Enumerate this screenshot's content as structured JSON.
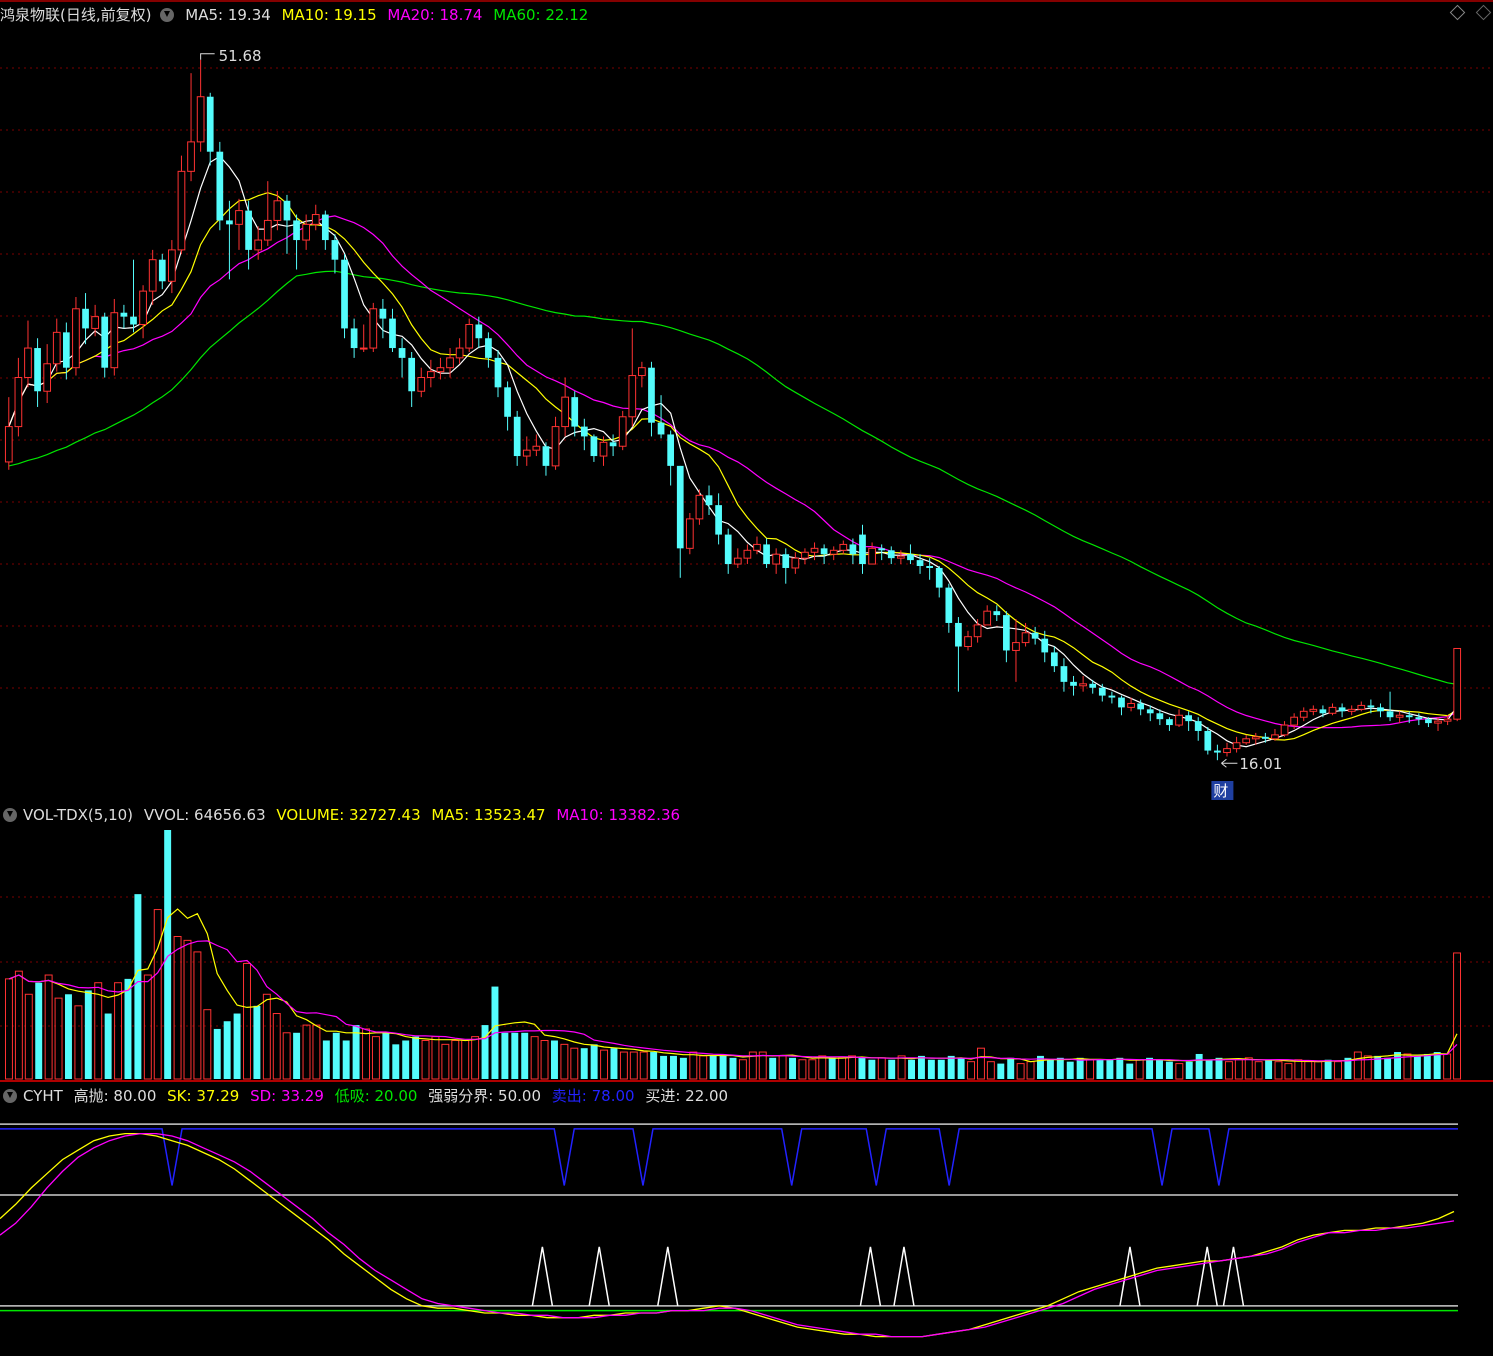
{
  "main_panel": {
    "title": "鸿泉物联(日线,前复权)",
    "ma5": "MA5: 19.34",
    "ma10": "MA10: 19.15",
    "ma20": "MA20: 18.74",
    "ma60": "MA60: 22.12",
    "high_label": "51.68",
    "low_label": "16.01",
    "event_badge": "财"
  },
  "volume_panel": {
    "title": "VOL-TDX(5,10)",
    "vvol": "VVOL: 64656.63",
    "volume": "VOLUME: 32727.43",
    "ma5": "MA5: 13523.47",
    "ma10": "MA10: 13382.36"
  },
  "indicator_panel": {
    "title": "CYHT",
    "gaopao": "高抛: 80.00",
    "sk": "SK: 37.29",
    "sd": "SD: 33.29",
    "dixi": "低吸: 20.00",
    "fenjie": "强弱分界: 50.00",
    "maichu": "卖出: 78.00",
    "mairu": "买进: 22.00"
  },
  "colors": {
    "up": "#ff3232",
    "down": "#54fcfc",
    "ma5": "#ffffff",
    "ma10": "#ffff00",
    "ma20": "#ff00ff",
    "ma60": "#00e600",
    "grid": "#7a0000",
    "divider": "#b00000",
    "sell": "#2222ff",
    "buy": "#ffffff"
  },
  "chart_data": [
    {
      "type": "candlestick",
      "ylim": [
        14.9,
        53.3
      ],
      "high": 51.68,
      "low": 16.01,
      "candles": [
        [
          33.0,
          31.2,
          34.5,
          30.8
        ],
        [
          35.5,
          33.0,
          36.5,
          32.5
        ],
        [
          37.0,
          35.5,
          38.4,
          35.0
        ],
        [
          34.8,
          37.0,
          37.5,
          34.0
        ],
        [
          36.2,
          34.8,
          37.2,
          34.2
        ],
        [
          37.8,
          36.2,
          38.5,
          35.8
        ],
        [
          36.0,
          37.8,
          38.3,
          35.4
        ],
        [
          39.0,
          36.0,
          39.6,
          35.6
        ],
        [
          38.0,
          39.0,
          39.8,
          37.2
        ],
        [
          38.6,
          38.0,
          39.2,
          37.6
        ],
        [
          36.0,
          38.6,
          38.8,
          35.5
        ],
        [
          38.8,
          36.0,
          39.5,
          35.6
        ],
        [
          38.6,
          38.8,
          39.2,
          38.0
        ],
        [
          38.2,
          38.6,
          41.5,
          37.8
        ],
        [
          39.9,
          38.2,
          40.2,
          37.5
        ],
        [
          41.5,
          39.9,
          42.0,
          39.2
        ],
        [
          40.4,
          41.5,
          41.8,
          40.0
        ],
        [
          42.0,
          40.4,
          42.5,
          39.8
        ],
        [
          46.0,
          42.0,
          46.8,
          41.8
        ],
        [
          47.5,
          46.0,
          51.0,
          45.5
        ],
        [
          49.8,
          47.5,
          51.68,
          47.0
        ],
        [
          47.0,
          49.8,
          50.0,
          46.3
        ],
        [
          43.5,
          47.0,
          47.5,
          43.0
        ],
        [
          43.3,
          43.5,
          44.5,
          40.5
        ],
        [
          44.0,
          43.3,
          44.6,
          42.0
        ],
        [
          42.0,
          44.0,
          44.5,
          41.0
        ],
        [
          42.5,
          42.0,
          43.2,
          41.5
        ],
        [
          43.5,
          42.5,
          45.5,
          42.2
        ],
        [
          44.5,
          43.5,
          45.0,
          43.0
        ],
        [
          43.5,
          44.5,
          44.8,
          41.8
        ],
        [
          42.5,
          43.5,
          43.8,
          41.0
        ],
        [
          43.3,
          42.5,
          43.8,
          42.0
        ],
        [
          43.8,
          43.3,
          44.3,
          43.0
        ],
        [
          42.5,
          43.8,
          44.0,
          42.0
        ],
        [
          41.5,
          42.5,
          42.8,
          40.8
        ],
        [
          38.0,
          41.5,
          41.8,
          37.5
        ],
        [
          37.0,
          38.0,
          38.5,
          36.5
        ],
        [
          37.0,
          37.0,
          38.2,
          36.8
        ],
        [
          39.0,
          37.0,
          39.3,
          36.8
        ],
        [
          38.5,
          39.0,
          39.5,
          37.5
        ],
        [
          37.0,
          38.5,
          39.0,
          36.8
        ],
        [
          36.5,
          37.0,
          37.5,
          35.5
        ],
        [
          34.8,
          36.5,
          36.8,
          34.0
        ],
        [
          35.5,
          34.8,
          36.0,
          34.5
        ],
        [
          35.8,
          35.5,
          36.4,
          35.0
        ],
        [
          36.0,
          35.8,
          36.5,
          35.4
        ],
        [
          36.5,
          36.0,
          37.0,
          35.5
        ],
        [
          37.0,
          36.5,
          37.5,
          36.2
        ],
        [
          38.2,
          37.0,
          38.5,
          36.8
        ],
        [
          37.5,
          38.2,
          38.6,
          37.0
        ],
        [
          36.5,
          37.5,
          37.8,
          36.0
        ],
        [
          35.0,
          36.5,
          36.9,
          34.5
        ],
        [
          33.5,
          35.0,
          35.3,
          32.8
        ],
        [
          31.5,
          33.5,
          33.8,
          31.0
        ],
        [
          31.8,
          31.5,
          32.5,
          31.0
        ],
        [
          32.0,
          31.8,
          32.6,
          31.5
        ],
        [
          31.0,
          32.0,
          32.2,
          30.5
        ],
        [
          33.0,
          31.0,
          33.5,
          30.8
        ],
        [
          34.5,
          33.0,
          35.5,
          32.5
        ],
        [
          33.0,
          34.5,
          34.8,
          32.5
        ],
        [
          32.5,
          33.0,
          33.4,
          31.8
        ],
        [
          31.5,
          32.5,
          32.6,
          31.2
        ],
        [
          32.2,
          31.5,
          32.5,
          31.0
        ],
        [
          32.0,
          32.2,
          32.6,
          31.5
        ],
        [
          33.5,
          32.0,
          33.8,
          31.8
        ],
        [
          35.6,
          33.5,
          38.0,
          33.0
        ],
        [
          36.0,
          35.6,
          36.3,
          35.0
        ],
        [
          33.2,
          36.0,
          36.3,
          32.5
        ],
        [
          32.6,
          33.2,
          34.6,
          32.4
        ],
        [
          31.0,
          32.6,
          32.8,
          30.0
        ],
        [
          26.8,
          31.0,
          31.0,
          25.3
        ],
        [
          28.3,
          26.8,
          28.6,
          26.5
        ],
        [
          29.5,
          28.3,
          29.8,
          28.0
        ],
        [
          29.0,
          29.5,
          30.0,
          28.5
        ],
        [
          27.5,
          29.0,
          29.6,
          27.0
        ],
        [
          26.0,
          27.5,
          27.8,
          25.5
        ],
        [
          26.3,
          26.0,
          26.8,
          25.8
        ],
        [
          26.7,
          26.3,
          27.0,
          26.0
        ],
        [
          27.0,
          26.7,
          27.4,
          26.5
        ],
        [
          26.0,
          27.0,
          27.3,
          25.8
        ],
        [
          26.5,
          26.0,
          26.8,
          25.5
        ],
        [
          25.8,
          26.5,
          26.8,
          25.0
        ],
        [
          26.3,
          25.8,
          26.6,
          25.5
        ],
        [
          26.6,
          26.3,
          26.8,
          26.0
        ],
        [
          26.8,
          26.6,
          27.1,
          26.2
        ],
        [
          26.5,
          26.8,
          27.0,
          26.0
        ],
        [
          26.7,
          26.5,
          26.9,
          26.2
        ],
        [
          27.0,
          26.7,
          27.2,
          26.5
        ],
        [
          26.5,
          27.0,
          27.3,
          26.0
        ],
        [
          26.0,
          27.5,
          28.0,
          25.5
        ],
        [
          26.8,
          26.0,
          27.1,
          26.2
        ],
        [
          26.7,
          26.8,
          27.0,
          26.2
        ],
        [
          26.3,
          26.7,
          26.9,
          26.0
        ],
        [
          26.4,
          26.3,
          26.7,
          26.0
        ],
        [
          26.2,
          26.5,
          27.0,
          26.0
        ],
        [
          25.9,
          26.2,
          26.5,
          25.5
        ],
        [
          25.8,
          25.9,
          26.3,
          25.2
        ],
        [
          24.8,
          25.8,
          25.9,
          24.3
        ],
        [
          23.0,
          24.8,
          25.0,
          22.5
        ],
        [
          21.8,
          23.0,
          23.3,
          19.5
        ],
        [
          22.3,
          21.8,
          22.6,
          21.6
        ],
        [
          22.9,
          22.3,
          23.2,
          22.0
        ],
        [
          23.6,
          22.9,
          23.9,
          23.0
        ],
        [
          23.4,
          23.6,
          23.9,
          23.1
        ],
        [
          21.6,
          23.4,
          23.6,
          21.0
        ],
        [
          22.0,
          21.6,
          23.2,
          20.0
        ],
        [
          22.5,
          22.0,
          23.0,
          21.8
        ],
        [
          22.2,
          22.5,
          22.8,
          21.9
        ],
        [
          21.5,
          22.2,
          22.6,
          21.0
        ],
        [
          20.8,
          21.5,
          21.8,
          20.5
        ],
        [
          20.0,
          20.8,
          21.2,
          19.5
        ],
        [
          19.8,
          20.0,
          20.3,
          19.3
        ],
        [
          19.9,
          19.8,
          20.3,
          19.5
        ],
        [
          19.7,
          19.9,
          20.1,
          19.4
        ],
        [
          19.3,
          19.7,
          19.9,
          19.0
        ],
        [
          19.2,
          19.3,
          19.5,
          18.9
        ],
        [
          18.7,
          19.2,
          19.3,
          18.3
        ],
        [
          18.9,
          18.7,
          19.2,
          18.5
        ],
        [
          18.6,
          18.9,
          19.1,
          18.3
        ],
        [
          18.4,
          18.6,
          18.8,
          18.0
        ],
        [
          18.1,
          18.4,
          18.6,
          17.8
        ],
        [
          17.8,
          18.1,
          18.2,
          17.5
        ],
        [
          18.3,
          17.8,
          18.6,
          17.7
        ],
        [
          18.0,
          18.3,
          18.5,
          17.5
        ],
        [
          17.5,
          18.0,
          18.2,
          17.0
        ],
        [
          16.5,
          17.5,
          17.7,
          16.3
        ],
        [
          16.4,
          16.5,
          16.8,
          16.01
        ],
        [
          16.6,
          16.4,
          16.9,
          16.2
        ],
        [
          16.9,
          16.6,
          17.2,
          16.4
        ],
        [
          17.1,
          16.9,
          17.3,
          16.8
        ],
        [
          17.2,
          17.1,
          17.4,
          16.8
        ],
        [
          17.1,
          17.2,
          17.4,
          16.9
        ],
        [
          17.3,
          17.1,
          17.6,
          17.0
        ],
        [
          17.8,
          17.3,
          18.0,
          17.2
        ],
        [
          18.2,
          17.8,
          18.4,
          17.6
        ],
        [
          18.5,
          18.2,
          18.7,
          18.0
        ],
        [
          18.6,
          18.5,
          18.8,
          18.3
        ],
        [
          18.4,
          18.6,
          18.8,
          18.2
        ],
        [
          18.7,
          18.4,
          18.9,
          18.3
        ],
        [
          18.5,
          18.7,
          18.9,
          18.2
        ],
        [
          18.6,
          18.5,
          18.8,
          18.3
        ],
        [
          18.8,
          18.6,
          19.0,
          18.5
        ],
        [
          18.7,
          18.8,
          19.1,
          18.4
        ],
        [
          18.5,
          18.7,
          18.9,
          18.2
        ],
        [
          18.2,
          18.5,
          19.5,
          18.0
        ],
        [
          18.3,
          18.2,
          18.5,
          17.9
        ],
        [
          18.2,
          18.3,
          18.5,
          17.9
        ],
        [
          18.1,
          18.2,
          18.4,
          17.8
        ],
        [
          17.9,
          18.1,
          18.2,
          17.7
        ],
        [
          18.0,
          17.9,
          18.2,
          17.5
        ],
        [
          18.1,
          18.0,
          18.3,
          17.8
        ],
        [
          21.7,
          18.1,
          21.7,
          18.0
        ]
      ]
    },
    {
      "type": "bar",
      "ylim": [
        0,
        64656.63
      ],
      "values": [
        26000,
        28000,
        22000,
        25000,
        27000,
        21000,
        22000,
        19000,
        23000,
        25000,
        17000,
        25000,
        26000,
        48000,
        27000,
        44000,
        64656.63,
        37000,
        36000,
        33000,
        18000,
        13000,
        15000,
        17000,
        30000,
        19000,
        22000,
        17000,
        12000,
        12000,
        14000,
        14000,
        10000,
        12000,
        10000,
        14000,
        13000,
        11000,
        12000,
        9000,
        10000,
        11000,
        10000,
        11000,
        9000,
        10000,
        10000,
        11000,
        14000,
        24000,
        12000,
        12000,
        12000,
        11000,
        10000,
        10000,
        9000,
        8000,
        8000,
        9000,
        7500,
        8000,
        7000,
        7000,
        7000,
        7000,
        6000,
        6000,
        5500,
        7000,
        6000,
        6000,
        6000,
        5500,
        5000,
        7000,
        7000,
        5500,
        6000,
        5500,
        5000,
        5000,
        6000,
        5500,
        5500,
        6000,
        5500,
        5000,
        5500,
        5000,
        6000,
        5000,
        6000,
        5000,
        5000,
        6000,
        5500,
        4500,
        8000,
        4500,
        4000,
        5500,
        4000,
        4500,
        6000,
        5000,
        5500,
        4500,
        5500,
        5000,
        5000,
        5000,
        5500,
        4000,
        5000,
        5500,
        5000,
        4500,
        4000,
        4500,
        6500,
        5000,
        5500,
        4500,
        5000,
        5500,
        4500,
        5000,
        4500,
        4000,
        5000,
        4500,
        4500,
        5000,
        4500,
        5500,
        7000,
        6000,
        6000,
        5500,
        7000,
        6500,
        6000,
        6500,
        7000,
        6500,
        32727.43
      ]
    },
    {
      "type": "line",
      "ylim": [
        0,
        100
      ],
      "levels": {
        "gaopao": 80,
        "fenjie": 50,
        "dixi": 20
      },
      "series": [
        {
          "name": "SK",
          "values": [
            54,
            60,
            67,
            73,
            79,
            83,
            87,
            89,
            90,
            90,
            89,
            87,
            85,
            82,
            79,
            75,
            70,
            65,
            60,
            55,
            50,
            45,
            39,
            34,
            29,
            24,
            20,
            17,
            16,
            16,
            15,
            14,
            14,
            13,
            13,
            12,
            12,
            12,
            13,
            13,
            14,
            14,
            14,
            15,
            15,
            16,
            17,
            16,
            14,
            12,
            10,
            8,
            7,
            6,
            5,
            5,
            4,
            4,
            4,
            4,
            5,
            6,
            7,
            9,
            11,
            13,
            15,
            17,
            20,
            23,
            25,
            27,
            29,
            31,
            33,
            34,
            35,
            36,
            36,
            37,
            38,
            40,
            42,
            45,
            47,
            48,
            49,
            49,
            50,
            50,
            51,
            52,
            54,
            57
          ]
        },
        {
          "name": "SD",
          "values": [
            47,
            52,
            59,
            67,
            74,
            80,
            84,
            87,
            89,
            90,
            90,
            89,
            87,
            84,
            81,
            78,
            74,
            69,
            64,
            59,
            54,
            48,
            43,
            37,
            32,
            28,
            24,
            20,
            18,
            17,
            16,
            15,
            14,
            14,
            13,
            13,
            12,
            12,
            12,
            13,
            13,
            14,
            14,
            15,
            15,
            15,
            16,
            16,
            15,
            13,
            11,
            9,
            8,
            7,
            6,
            5,
            5,
            4,
            4,
            4,
            5,
            6,
            7,
            8,
            10,
            12,
            14,
            16,
            18,
            21,
            24,
            26,
            28,
            30,
            32,
            33,
            34,
            35,
            36,
            37,
            38,
            39,
            41,
            44,
            46,
            48,
            48,
            49,
            49,
            50,
            50,
            51,
            52,
            53
          ]
        }
      ],
      "sell_signal_x": [
        0.118,
        0.387,
        0.441,
        0.543,
        0.601,
        0.651,
        0.797,
        0.836
      ],
      "buy_signal_x": [
        0.372,
        0.411,
        0.458,
        0.597,
        0.62,
        0.775,
        0.828,
        0.846
      ]
    }
  ]
}
